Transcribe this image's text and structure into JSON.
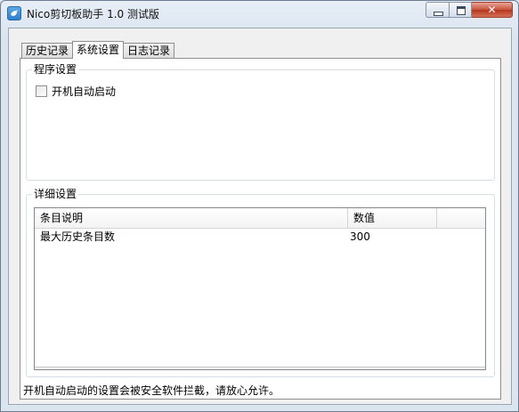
{
  "window": {
    "title": "Nico剪切板助手 1.0 测试版"
  },
  "tabs": [
    {
      "label": "历史记录",
      "active": false
    },
    {
      "label": "系统设置",
      "active": true
    },
    {
      "label": "日志记录",
      "active": false
    }
  ],
  "program_settings": {
    "title": "程序设置",
    "autostart_label": "开机自动启动",
    "autostart_checked": false
  },
  "detail_settings": {
    "title": "详细设置",
    "columns": [
      "条目说明",
      "数值"
    ],
    "rows": [
      {
        "name": "最大历史条目数",
        "value": "300"
      }
    ]
  },
  "footer": {
    "note": "开机自动启动的设置会被安全软件拦截，请放心允许。"
  },
  "colors": {
    "window_frame": "#dfe7f1",
    "close_button": "#c8523c",
    "client_bg": "#f0f0f0",
    "panel_bg": "#ffffff"
  }
}
